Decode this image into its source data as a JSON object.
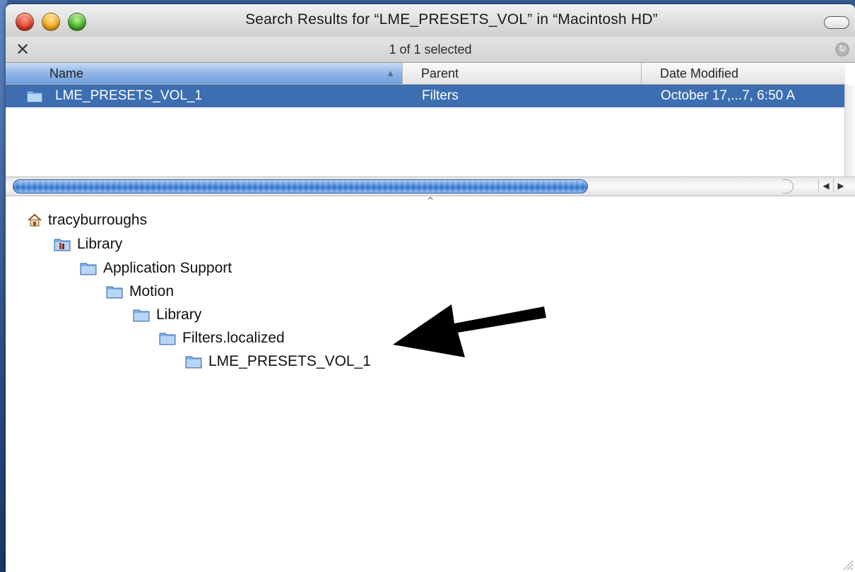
{
  "window": {
    "title": "Search Results for “LME_PRESETS_VOL” in “Macintosh HD”"
  },
  "status": {
    "text": "1 of 1 selected"
  },
  "columns": {
    "name": "Name",
    "parent": "Parent",
    "date": "Date Modified"
  },
  "results": [
    {
      "name": "LME_PRESETS_VOL_1",
      "parent": "Filters",
      "date": "October 17,...7, 6:50 A",
      "selected": true
    }
  ],
  "path": [
    {
      "label": "tracyburroughs",
      "icon": "home-icon"
    },
    {
      "label": "Library",
      "icon": "library-folder-icon"
    },
    {
      "label": "Application Support",
      "icon": "folder-icon"
    },
    {
      "label": "Motion",
      "icon": "folder-icon"
    },
    {
      "label": "Library",
      "icon": "folder-icon"
    },
    {
      "label": "Filters.localized",
      "icon": "folder-icon"
    },
    {
      "label": "LME_PRESETS_VOL_1",
      "icon": "folder-icon"
    }
  ],
  "colors": {
    "selection": "#3c6eb1",
    "scroll_thumb": "#2c6cc8",
    "desktop": "#3a5f96"
  }
}
